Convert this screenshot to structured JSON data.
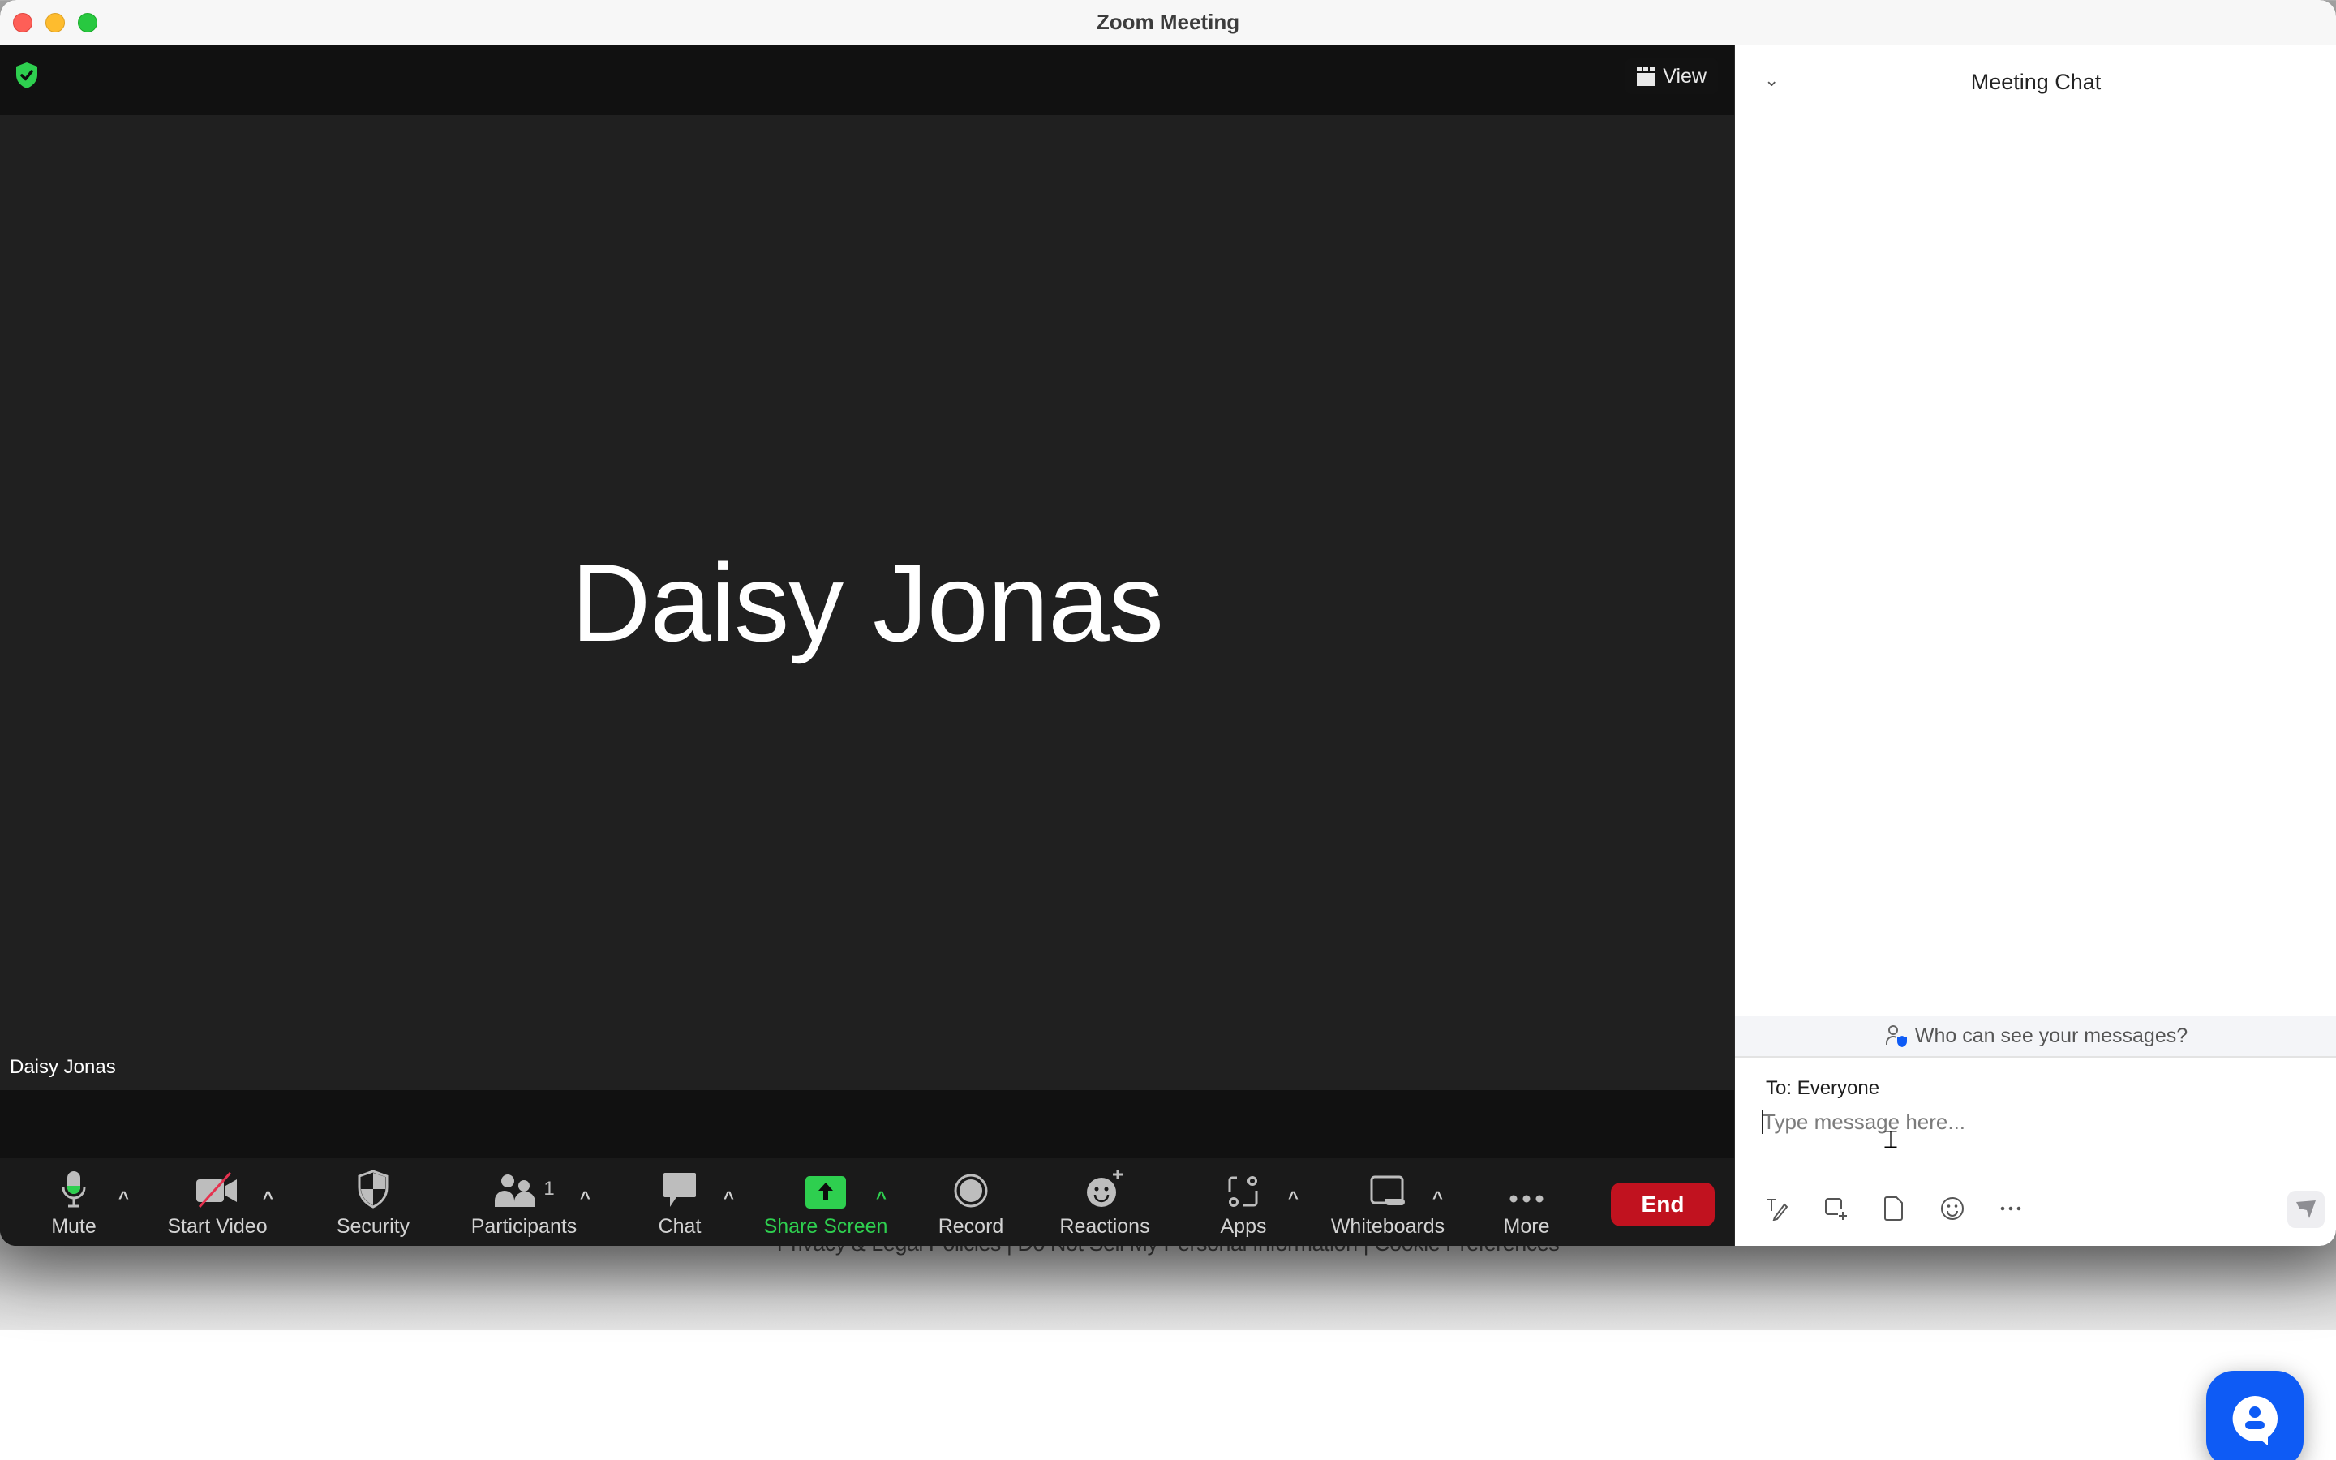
{
  "window": {
    "title": "Zoom Meeting"
  },
  "meeting": {
    "view_label": "View",
    "participant_display_name": "Daisy Jonas",
    "participant_tile_label": "Daisy Jonas",
    "security_status": "encrypted"
  },
  "toolbar": {
    "items": [
      {
        "id": "mute",
        "label": "Mute",
        "icon": "microphone-icon",
        "has_menu": true
      },
      {
        "id": "start-video",
        "label": "Start Video",
        "icon": "video-off-icon",
        "has_menu": true
      },
      {
        "id": "security",
        "label": "Security",
        "icon": "shield-icon",
        "has_menu": false
      },
      {
        "id": "participants",
        "label": "Participants",
        "icon": "participants-icon",
        "count": "1",
        "has_menu": true
      },
      {
        "id": "chat",
        "label": "Chat",
        "icon": "chat-bubble-icon",
        "has_menu": true
      },
      {
        "id": "share-screen",
        "label": "Share Screen",
        "icon": "share-screen-icon",
        "has_menu": true
      },
      {
        "id": "record",
        "label": "Record",
        "icon": "record-icon",
        "has_menu": false
      },
      {
        "id": "reactions",
        "label": "Reactions",
        "icon": "reactions-icon",
        "has_menu": false
      },
      {
        "id": "apps",
        "label": "Apps",
        "icon": "apps-icon",
        "has_menu": true
      },
      {
        "id": "whiteboards",
        "label": "Whiteboards",
        "icon": "whiteboard-icon",
        "has_menu": true
      },
      {
        "id": "more",
        "label": "More",
        "icon": "more-icon",
        "has_menu": false
      }
    ],
    "end_label": "End",
    "colors": {
      "share_green": "#2ecf4f",
      "end_red": "#c1121f",
      "mic_level_green": "#2ecf4f"
    }
  },
  "chat": {
    "title": "Meeting Chat",
    "privacy_notice": "Who can see your messages?",
    "to_label": "To: Everyone",
    "input_placeholder": "Type message here...",
    "input_value": "",
    "tools": [
      "format-text-icon",
      "screenshot-icon",
      "file-icon",
      "emoji-icon",
      "more-icon"
    ]
  },
  "background_page": {
    "footer_text": "Privacy & Legal Policies | Do Not Sell My Personal Information | Cookie Preferences"
  }
}
